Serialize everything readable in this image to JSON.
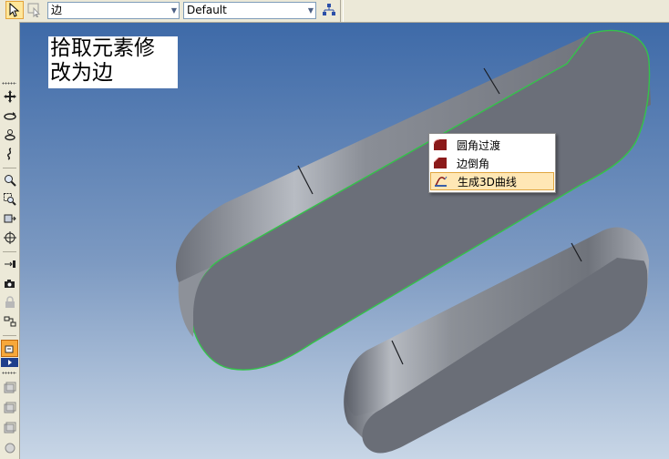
{
  "toolbar": {
    "select_mode_icon": "arrow-cursor-icon",
    "filter_icon": "select-filter-icon",
    "element_filter_value": "边",
    "view_style_value": "Default",
    "tree_icon": "hierarchy-icon"
  },
  "left_toolbar": {
    "icons": [
      "pan-icon",
      "rotate-icon",
      "orbit-icon",
      "walk-icon",
      "zoom-icon",
      "zoom-window-icon",
      "zoom-fit-icon",
      "view-center-icon",
      "camera-target-icon",
      "camera-icon",
      "lock-icon",
      "view-tool-icon",
      "color-icon",
      "sheet1-icon",
      "sheet2-icon",
      "sheet3-icon",
      "sheet4-icon"
    ]
  },
  "annotation": {
    "line1": "拾取元素修",
    "line2": "改为边"
  },
  "context_menu": {
    "items": [
      {
        "label": "圆角过渡",
        "icon": "fillet-icon"
      },
      {
        "label": "边倒角",
        "icon": "chamfer-icon"
      },
      {
        "label": "生成3D曲线",
        "icon": "3d-curve-icon",
        "highlighted": true
      }
    ]
  },
  "colors": {
    "selection_edge": "#34c34a",
    "menu_highlight": "#ffe7b5",
    "viewport_top": "#3e6aa8",
    "viewport_bottom": "#c8d6e6",
    "part_face": "#6b6f79"
  }
}
